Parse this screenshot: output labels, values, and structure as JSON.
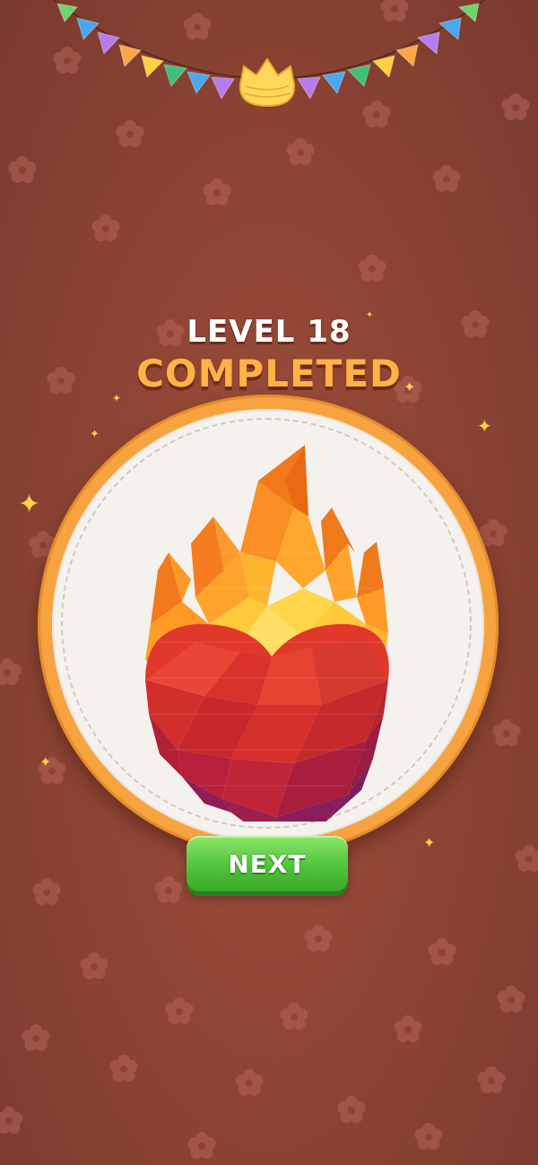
{
  "level_title": "LEVEL 18",
  "completed_label": "COMPLETED",
  "next_button": {
    "label": "NEXT"
  },
  "artwork": {
    "subject": "flaming heart knit pattern"
  },
  "colors": {
    "background": "#8f4534",
    "hoop": "#f7a340",
    "completed_text": "#ffb347",
    "button": "#4fc53a"
  },
  "icons": [
    "bunting-icon",
    "crown-icon",
    "sparkle-icon",
    "flower-icon"
  ]
}
